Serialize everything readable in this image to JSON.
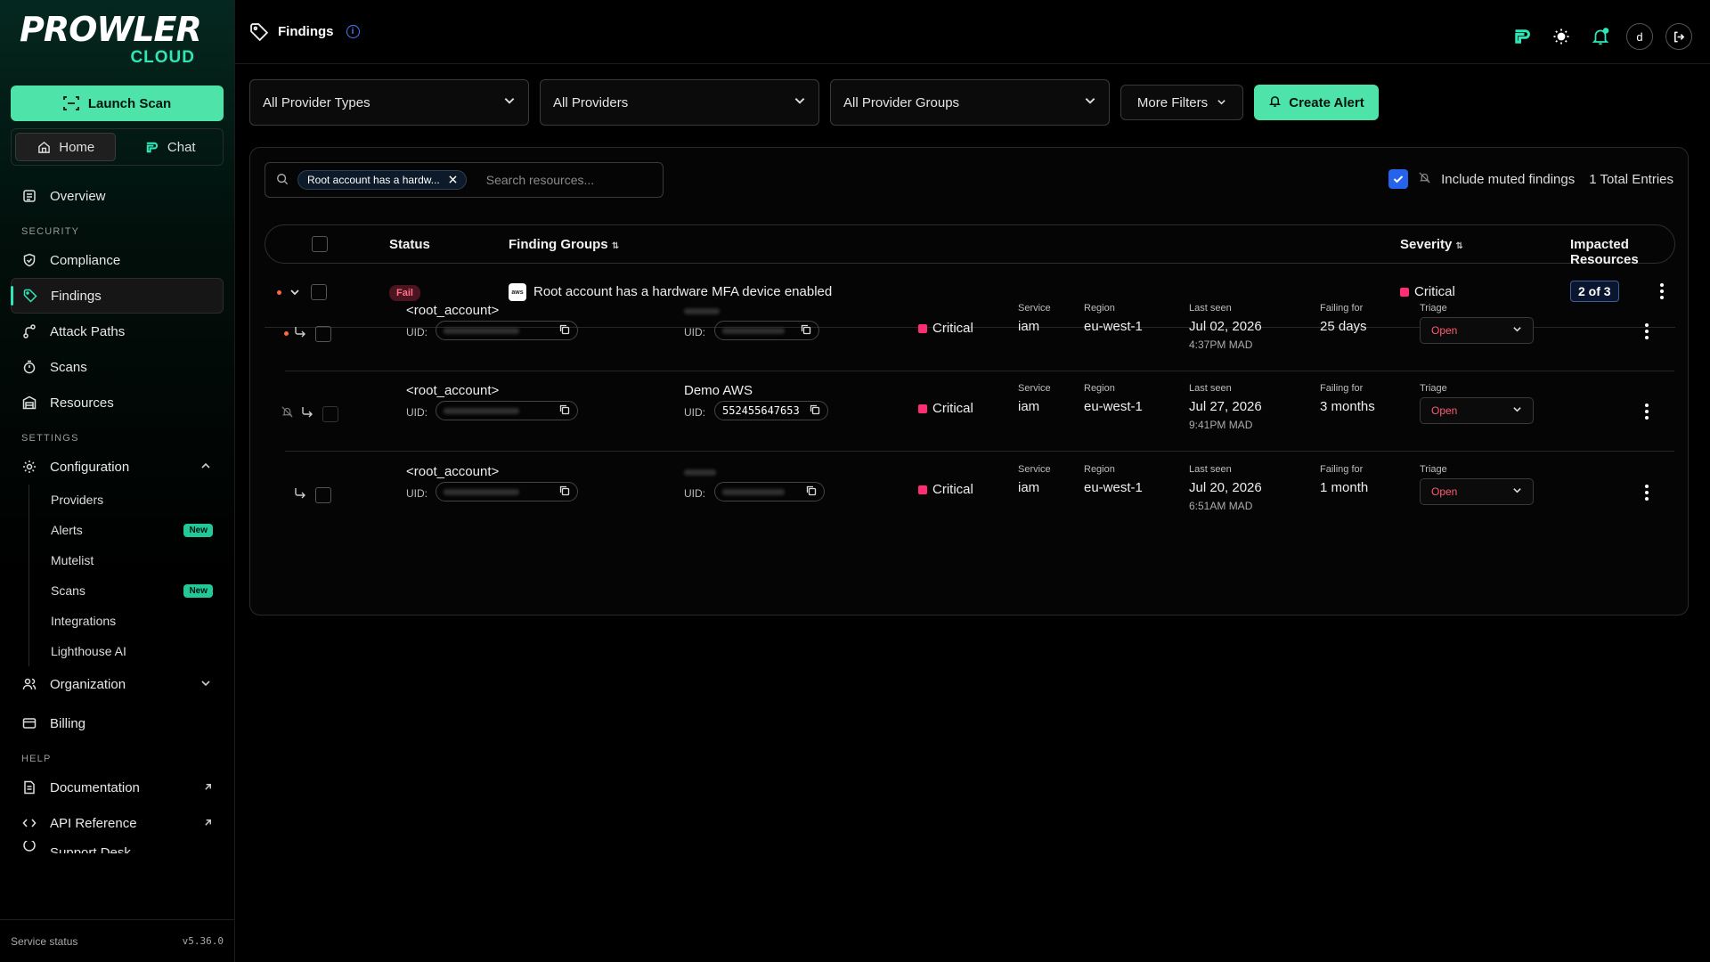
{
  "brand": {
    "word": "PROWLER",
    "cloud": "CLOUD"
  },
  "sidebar": {
    "launch_label": "Launch Scan",
    "tabs": [
      {
        "label": "Home"
      },
      {
        "label": "Chat"
      }
    ],
    "overview": "Overview",
    "section_security": "SECURITY",
    "security_items": [
      "Compliance",
      "Findings",
      "Attack Paths",
      "Scans",
      "Resources"
    ],
    "section_settings": "SETTINGS",
    "configuration": "Configuration",
    "config_items": [
      {
        "label": "Providers",
        "badge": ""
      },
      {
        "label": "Alerts",
        "badge": "New"
      },
      {
        "label": "Mutelist",
        "badge": ""
      },
      {
        "label": "Scans",
        "badge": "New"
      },
      {
        "label": "Integrations",
        "badge": ""
      },
      {
        "label": "Lighthouse AI",
        "badge": ""
      }
    ],
    "organization": "Organization",
    "billing": "Billing",
    "section_help": "HELP",
    "documentation": "Documentation",
    "api_reference": "API Reference",
    "support_desk": "Support Desk",
    "service_status": "Service status",
    "version": "v5.36.0"
  },
  "header": {
    "title": "Findings",
    "avatar": "d"
  },
  "filters": {
    "provider_types": "All Provider Types",
    "providers": "All Providers",
    "provider_groups": "All Provider Groups",
    "more": "More Filters",
    "create_alert": "Create Alert"
  },
  "search": {
    "chip": "Root account has a hardw...",
    "placeholder": "Search resources..."
  },
  "muted": {
    "label": "Include muted findings",
    "total": "1 Total Entries"
  },
  "table": {
    "headers": {
      "status": "Status",
      "groups": "Finding Groups",
      "severity": "Severity",
      "impacted": "Impacted Resources"
    },
    "group": {
      "status": "Fail",
      "title": "Root account has a hardware MFA device enabled",
      "severity": "Critical",
      "impacted": "2 of 3"
    },
    "resources": [
      {
        "name": "<root_account>",
        "uid_label": "UID:",
        "provider": "",
        "severity": "Critical",
        "service_label": "Service",
        "service": "iam",
        "region_label": "Region",
        "region": "eu-west-1",
        "seen_label": "Last seen",
        "seen_date": "Jul 02, 2026",
        "seen_time": "4:37PM MAD",
        "failing_label": "Failing for",
        "failing": "25 days",
        "triage_label": "Triage",
        "triage": "Open"
      },
      {
        "name": "<root_account>",
        "uid_label": "UID:",
        "provider": "Demo AWS",
        "provider_uid": "552455647653",
        "severity": "Critical",
        "service_label": "Service",
        "service": "iam",
        "region_label": "Region",
        "region": "eu-west-1",
        "seen_label": "Last seen",
        "seen_date": "Jul 27, 2026",
        "seen_time": "9:41PM MAD",
        "failing_label": "Failing for",
        "failing": "3 months",
        "triage_label": "Triage",
        "triage": "Open"
      },
      {
        "name": "<root_account>",
        "uid_label": "UID:",
        "provider": "",
        "severity": "Critical",
        "service_label": "Service",
        "service": "iam",
        "region_label": "Region",
        "region": "eu-west-1",
        "seen_label": "Last seen",
        "seen_date": "Jul 20, 2026",
        "seen_time": "6:51AM MAD",
        "failing_label": "Failing for",
        "failing": "1 month",
        "triage_label": "Triage",
        "triage": "Open"
      }
    ]
  },
  "colors": {
    "accent": "#4ee3a8",
    "critical": "#ff2e74",
    "fail_text": "#ff7088",
    "link_blue": "#2563eb"
  }
}
